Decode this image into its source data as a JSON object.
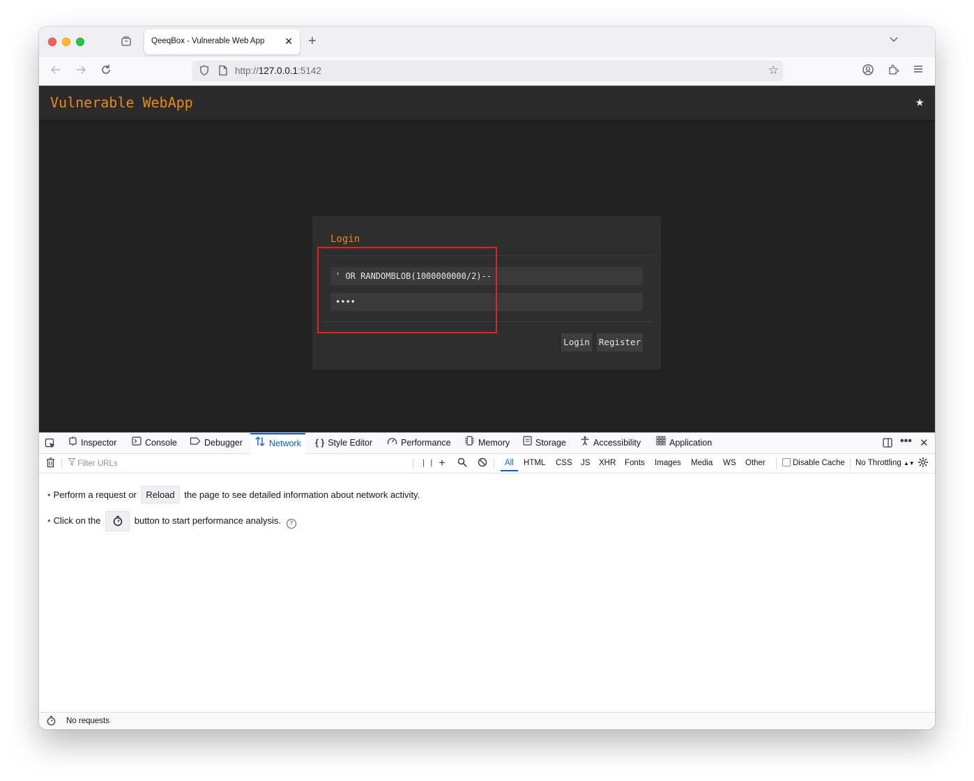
{
  "browser": {
    "tab_title": "QeeqBox - Vulnerable Web App",
    "url_scheme": "http://",
    "url_host": "127.0.0.1",
    "url_port": ":5142"
  },
  "site": {
    "title": "Vulnerable WebApp",
    "login": {
      "heading": "Login",
      "username_value": "' OR RANDOMBLOB(1000000000/2)--",
      "password_value": "••••",
      "login_button": "Login",
      "register_button": "Register"
    },
    "highlight_color": "#e0261a",
    "accent_color": "#e8891a"
  },
  "devtools": {
    "tabs": [
      {
        "label": "Inspector",
        "icon": "inspector-icon"
      },
      {
        "label": "Console",
        "icon": "console-icon"
      },
      {
        "label": "Debugger",
        "icon": "debugger-icon"
      },
      {
        "label": "Network",
        "icon": "network-icon",
        "active": true
      },
      {
        "label": "Style Editor",
        "icon": "style-editor-icon"
      },
      {
        "label": "Performance",
        "icon": "performance-icon"
      },
      {
        "label": "Memory",
        "icon": "memory-icon"
      },
      {
        "label": "Storage",
        "icon": "storage-icon"
      },
      {
        "label": "Accessibility",
        "icon": "accessibility-icon"
      },
      {
        "label": "Application",
        "icon": "application-icon"
      }
    ],
    "filter_placeholder": "Filter URLs",
    "filter_types": [
      "All",
      "HTML",
      "CSS",
      "JS",
      "XHR",
      "Fonts",
      "Images",
      "Media",
      "WS",
      "Other"
    ],
    "disable_cache": "Disable Cache",
    "throttling": "No Throttling",
    "msg1_before": "Perform a request or",
    "msg1_button": "Reload",
    "msg1_after": "the page to see detailed information about network activity.",
    "msg2_before": "Click on the",
    "msg2_after": "button to start performance analysis.",
    "status": "No requests",
    "active_color": "#0061e0"
  }
}
